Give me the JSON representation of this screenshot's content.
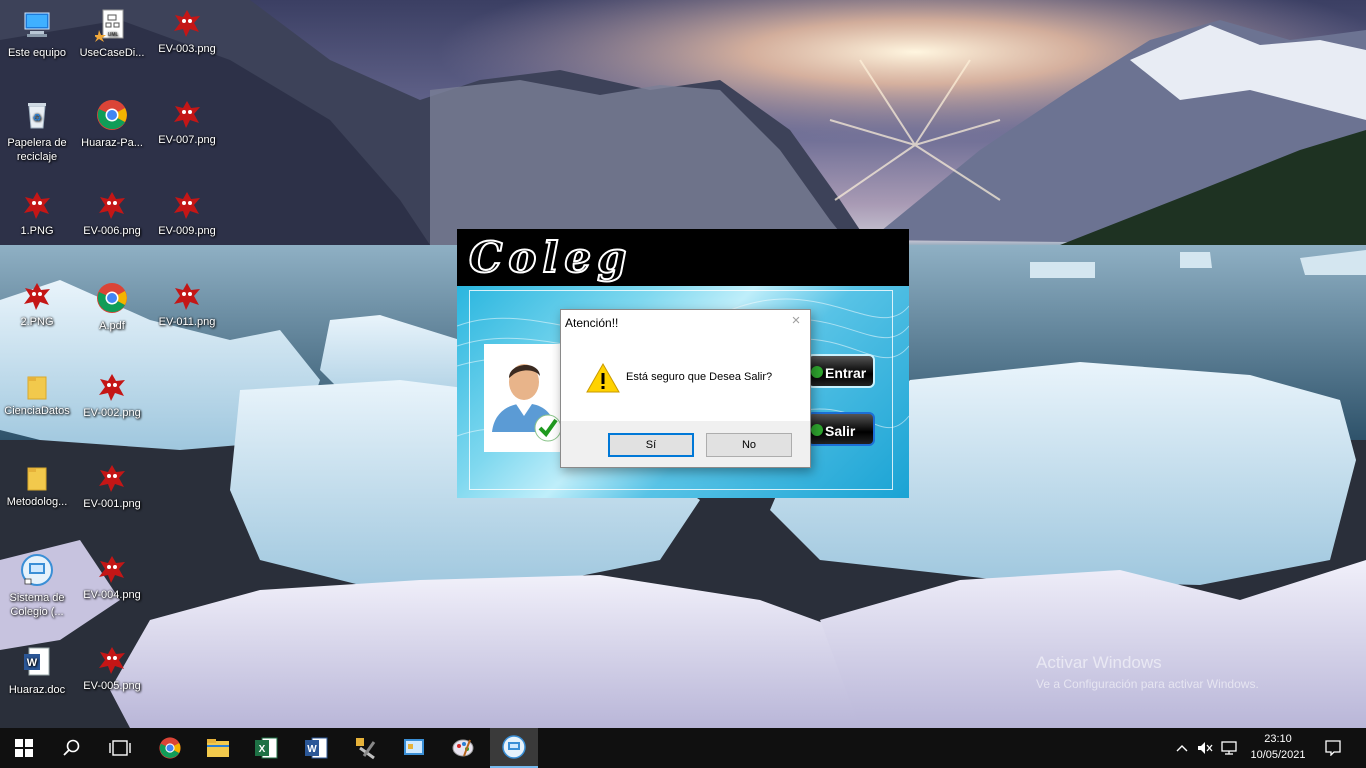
{
  "desktop": {
    "icons": [
      {
        "label": "Este equipo",
        "icon": "computer-icon"
      },
      {
        "label": "UseCaseDi...",
        "icon": "uml-file-icon"
      },
      {
        "label": "EV-003.png",
        "icon": "image-monster-icon"
      },
      {
        "label": "Papelera de reciclaje",
        "icon": "recycle-bin-icon"
      },
      {
        "label": "Huaraz-Pa...",
        "icon": "chrome-icon"
      },
      {
        "label": "EV-007.png",
        "icon": "image-monster-icon"
      },
      {
        "label": "1.PNG",
        "icon": "image-monster-icon"
      },
      {
        "label": "EV-006.png",
        "icon": "image-monster-icon"
      },
      {
        "label": "EV-009.png",
        "icon": "image-monster-icon"
      },
      {
        "label": "2.PNG",
        "icon": "image-monster-icon"
      },
      {
        "label": "A.pdf",
        "icon": "chrome-icon"
      },
      {
        "label": "EV-011.png",
        "icon": "image-monster-icon"
      },
      {
        "label": "CienciaDatos",
        "icon": "folder-icon"
      },
      {
        "label": "EV-002.png",
        "icon": "image-monster-icon"
      },
      {
        "label": "Metodolog...",
        "icon": "folder-icon"
      },
      {
        "label": "EV-001.png",
        "icon": "image-monster-icon"
      },
      {
        "label": "Sistema de Colegio (...",
        "icon": "app-shortcut-icon"
      },
      {
        "label": "EV-004.png",
        "icon": "image-monster-icon"
      },
      {
        "label": "Huaraz.doc",
        "icon": "word-doc-icon"
      },
      {
        "label": "EV-005.png",
        "icon": "image-monster-icon"
      }
    ]
  },
  "app": {
    "logo_text": "Coleg",
    "enter_label": "Entrar",
    "exit_label": "Salir"
  },
  "dialog": {
    "title": "Atención!!",
    "message": "Está seguro que Desea Salir?",
    "yes_label": "Sí",
    "no_label": "No",
    "close_glyph": "×"
  },
  "watermark": {
    "line1": "Activar Windows",
    "line2": "Ve a Configuración para activar Windows."
  },
  "taskbar": {
    "apps": [
      "start",
      "search",
      "task-view",
      "chrome",
      "file-explorer",
      "excel",
      "word",
      "tool",
      "sistema-colegio",
      "paint",
      "coleg-app"
    ],
    "active_app": "coleg-app",
    "time": "23:10",
    "date": "10/05/2021"
  },
  "colors": {
    "accent": "#0078d7",
    "taskbar_bg": "#101010",
    "app_header_bg": "#000000",
    "app_body": "#2ab6df"
  }
}
